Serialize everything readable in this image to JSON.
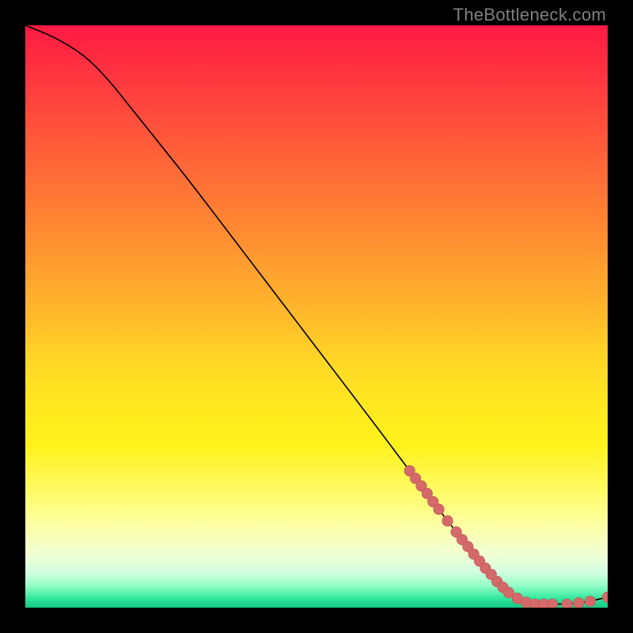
{
  "watermark": "TheBottleneck.com",
  "colors": {
    "curve_stroke": "#000000",
    "marker_fill": "#d46a6a",
    "marker_stroke": "#c95a5a"
  },
  "chart_data": {
    "type": "line",
    "title": "",
    "xlabel": "",
    "ylabel": "",
    "xlim": [
      0,
      100
    ],
    "ylim": [
      0,
      100
    ],
    "grid": false,
    "legend": false,
    "curve": [
      {
        "x": 0,
        "y": 100
      },
      {
        "x": 5,
        "y": 98
      },
      {
        "x": 10,
        "y": 95
      },
      {
        "x": 14,
        "y": 91
      },
      {
        "x": 18,
        "y": 86
      },
      {
        "x": 22,
        "y": 81
      },
      {
        "x": 28,
        "y": 73.5
      },
      {
        "x": 36,
        "y": 63
      },
      {
        "x": 44,
        "y": 52.5
      },
      {
        "x": 52,
        "y": 42
      },
      {
        "x": 60,
        "y": 31.5
      },
      {
        "x": 66,
        "y": 23.5
      },
      {
        "x": 72,
        "y": 15.5
      },
      {
        "x": 78,
        "y": 8
      },
      {
        "x": 82,
        "y": 3.5
      },
      {
        "x": 85,
        "y": 1.2
      },
      {
        "x": 88,
        "y": 0.6
      },
      {
        "x": 92,
        "y": 0.6
      },
      {
        "x": 96,
        "y": 0.9
      },
      {
        "x": 100,
        "y": 1.8
      }
    ],
    "markers": [
      {
        "x": 66,
        "y": 23.5
      },
      {
        "x": 67,
        "y": 22.2
      },
      {
        "x": 68,
        "y": 20.9
      },
      {
        "x": 69,
        "y": 19.6
      },
      {
        "x": 70,
        "y": 18.2
      },
      {
        "x": 71,
        "y": 16.9
      },
      {
        "x": 72.5,
        "y": 14.9
      },
      {
        "x": 74,
        "y": 13.0
      },
      {
        "x": 75,
        "y": 11.7
      },
      {
        "x": 76,
        "y": 10.5
      },
      {
        "x": 77,
        "y": 9.2
      },
      {
        "x": 78,
        "y": 8.0
      },
      {
        "x": 79,
        "y": 6.8
      },
      {
        "x": 80,
        "y": 5.7
      },
      {
        "x": 81,
        "y": 4.5
      },
      {
        "x": 82,
        "y": 3.5
      },
      {
        "x": 83,
        "y": 2.6
      },
      {
        "x": 84.5,
        "y": 1.6
      },
      {
        "x": 86,
        "y": 0.9
      },
      {
        "x": 87.5,
        "y": 0.6
      },
      {
        "x": 89,
        "y": 0.6
      },
      {
        "x": 90.5,
        "y": 0.6
      },
      {
        "x": 93,
        "y": 0.6
      },
      {
        "x": 95,
        "y": 0.8
      },
      {
        "x": 97,
        "y": 1.1
      },
      {
        "x": 100,
        "y": 1.8
      }
    ]
  }
}
